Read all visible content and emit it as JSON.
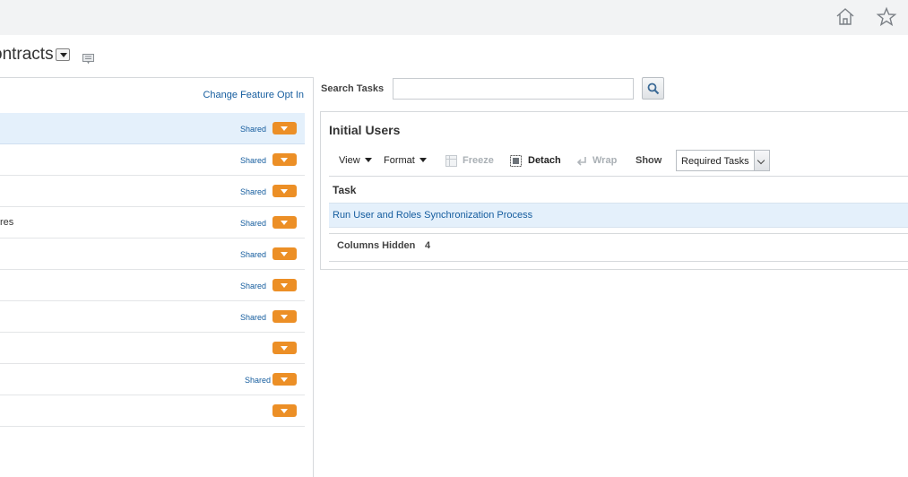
{
  "header": {
    "icons": [
      "home-icon",
      "star-icon"
    ]
  },
  "page": {
    "title": "ontracts"
  },
  "left_panel": {
    "change_link": "Change Feature Opt In",
    "rows": [
      {
        "text": "",
        "shared": "Shared",
        "selected": true
      },
      {
        "text": "",
        "shared": "Shared"
      },
      {
        "text": "",
        "shared": "Shared"
      },
      {
        "text": "res",
        "shared": "Shared"
      },
      {
        "text": "",
        "shared": "Shared"
      },
      {
        "text": "",
        "shared": "Shared"
      },
      {
        "text": "",
        "shared": "Shared"
      },
      {
        "text": "",
        "shared": ""
      },
      {
        "text": "",
        "shared": "Shared"
      },
      {
        "text": "",
        "shared": ""
      }
    ]
  },
  "search": {
    "label": "Search Tasks",
    "value": "",
    "placeholder": ""
  },
  "right_panel": {
    "title": "Initial Users",
    "toolbar": {
      "view": "View",
      "format": "Format",
      "freeze": "Freeze",
      "detach": "Detach",
      "wrap": "Wrap",
      "show_label": "Show",
      "show_value": "Required Tasks"
    },
    "table": {
      "column": "Task",
      "rows": [
        "Run User and Roles Synchronization Process"
      ]
    },
    "columns_hidden_label": "Columns Hidden",
    "columns_hidden_count": "4"
  },
  "colors": {
    "accent_orange": "#ec8f26",
    "link_blue": "#145c9e",
    "selected_row": "#e4f0fb"
  }
}
